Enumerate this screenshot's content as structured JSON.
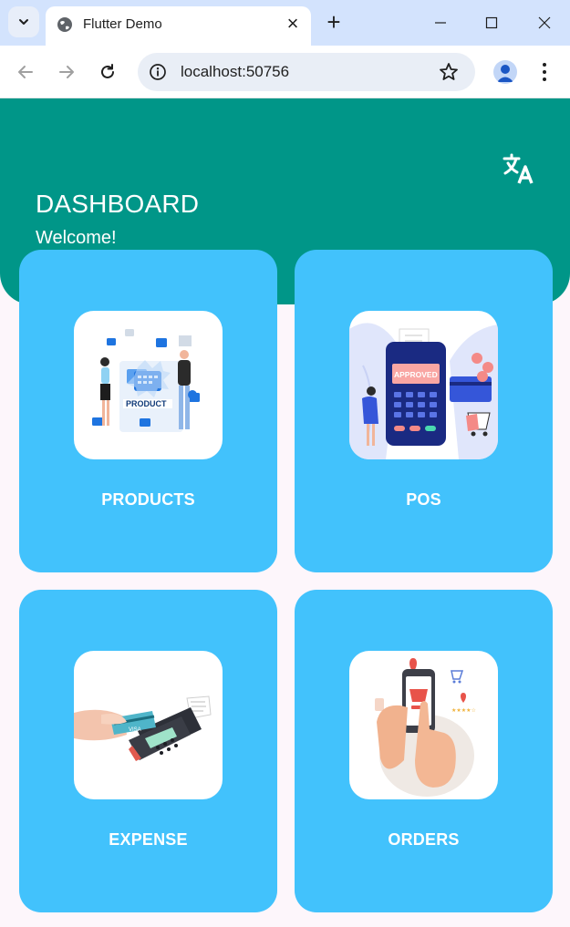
{
  "browser": {
    "tab_title": "Flutter Demo",
    "url": "localhost:50756"
  },
  "header": {
    "title": "DASHBOARD",
    "subtitle": "Welcome!"
  },
  "cards": [
    {
      "label": "PRODUCTS",
      "icon": "products-illustration"
    },
    {
      "label": "POS",
      "icon": "pos-terminal-illustration"
    },
    {
      "label": "EXPENSE",
      "icon": "card-payment-illustration"
    },
    {
      "label": "ORDERS",
      "icon": "mobile-order-illustration"
    }
  ],
  "colors": {
    "header": "#009688",
    "card": "#42c2fc",
    "background": "#fdf6fb"
  }
}
